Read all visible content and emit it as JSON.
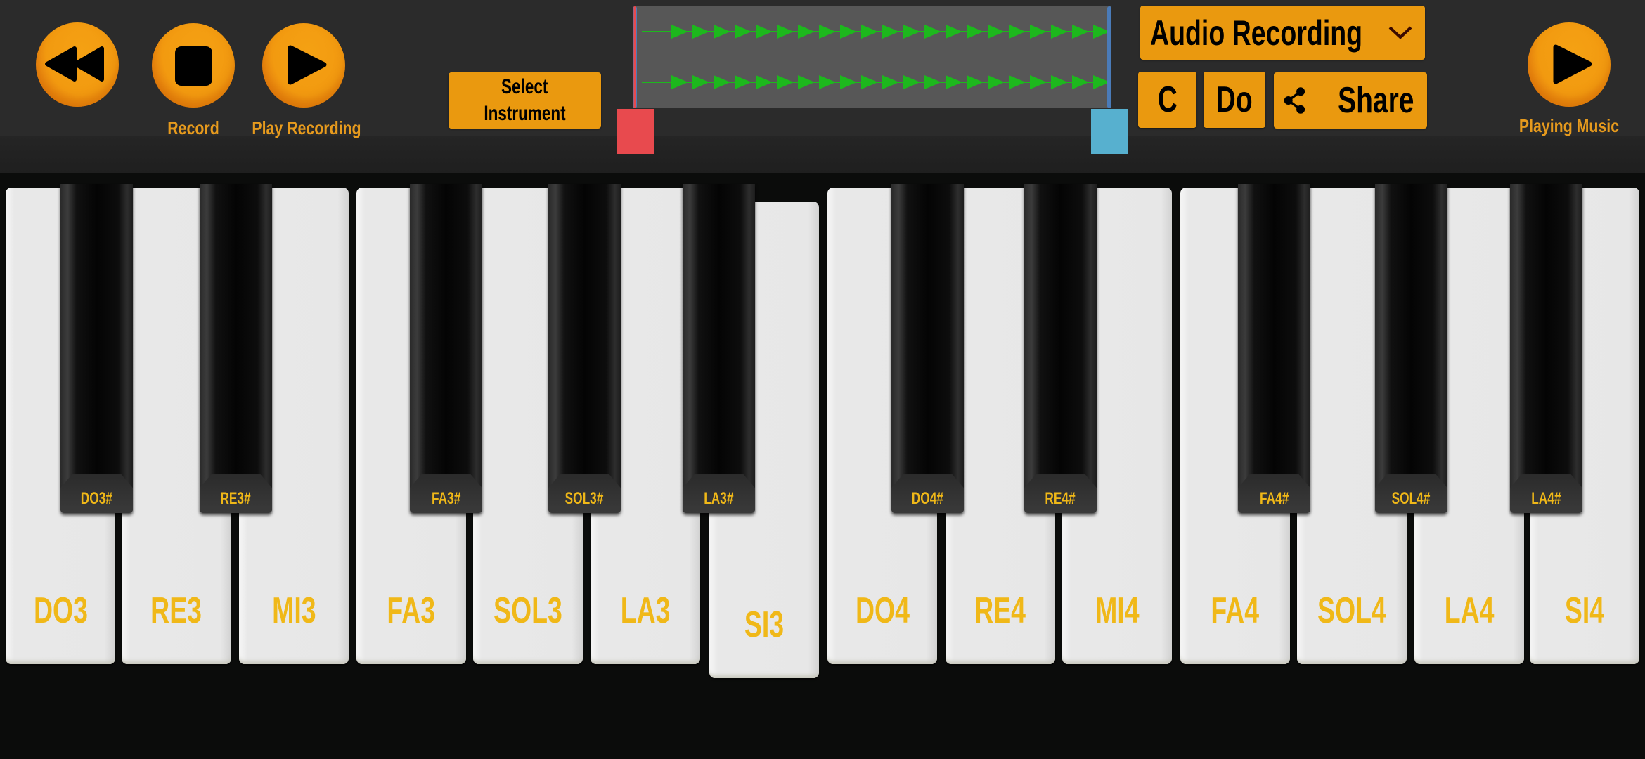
{
  "header": {
    "rewind_button": {
      "icon": "rewind-icon"
    },
    "record_button": {
      "icon": "stop-icon",
      "label": "Record"
    },
    "play_recording_button": {
      "icon": "play-icon",
      "label": "Play Recording"
    },
    "select_instrument_button": {
      "line1": "Select",
      "line2": "Instrument"
    },
    "waveform": {
      "tracks": 2,
      "wave_color": "#1db81d",
      "start_handle_color": "#e84a4e",
      "end_handle_color": "#57b0cf"
    },
    "mode_dropdown": {
      "selected": "Audio Recording",
      "icon": "chevron-down-icon"
    },
    "notation_c_button": "C",
    "notation_do_button": "Do",
    "share_button": {
      "label": "Share",
      "icon": "share-icon"
    },
    "playing_music_button": {
      "icon": "play-icon",
      "label": "Playing Music"
    }
  },
  "colors": {
    "accent": "#ea990f",
    "label": "#f0b818",
    "background": "#2b2b2b"
  },
  "keyboard": {
    "white_keys": [
      {
        "label": "DO3",
        "pressed": false
      },
      {
        "label": "RE3",
        "pressed": false
      },
      {
        "label": "MI3",
        "pressed": false
      },
      {
        "label": "FA3",
        "pressed": false
      },
      {
        "label": "SOL3",
        "pressed": false
      },
      {
        "label": "LA3",
        "pressed": false
      },
      {
        "label": "SI3",
        "pressed": true
      },
      {
        "label": "DO4",
        "pressed": false
      },
      {
        "label": "RE4",
        "pressed": false
      },
      {
        "label": "MI4",
        "pressed": false
      },
      {
        "label": "FA4",
        "pressed": false
      },
      {
        "label": "SOL4",
        "pressed": false
      },
      {
        "label": "LA4",
        "pressed": false
      },
      {
        "label": "SI4",
        "pressed": false
      }
    ],
    "black_keys": [
      {
        "label": "DO3#"
      },
      {
        "label": "RE3#"
      },
      {
        "label": "FA3#"
      },
      {
        "label": "SOL3#"
      },
      {
        "label": "LA3#"
      },
      {
        "label": "DO4#"
      },
      {
        "label": "RE4#"
      },
      {
        "label": "FA4#"
      },
      {
        "label": "SOL4#"
      },
      {
        "label": "LA4#"
      }
    ]
  }
}
